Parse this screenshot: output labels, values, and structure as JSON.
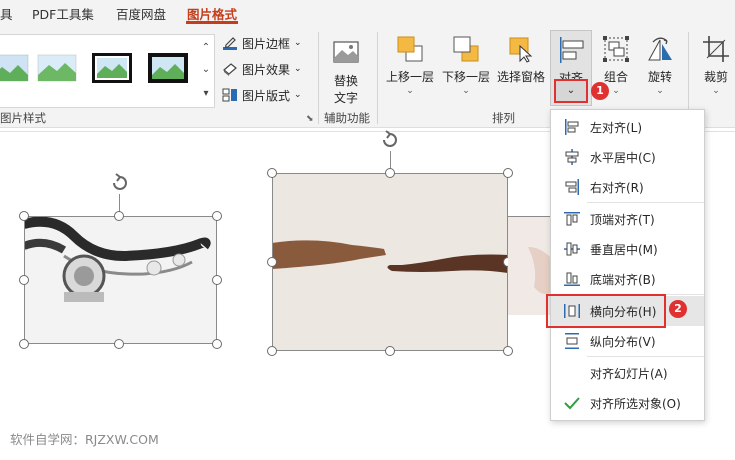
{
  "tabs": [
    {
      "label": "具",
      "active": false
    },
    {
      "label": "PDF工具集",
      "active": false
    },
    {
      "label": "百度网盘",
      "active": false
    },
    {
      "label": "图片格式",
      "active": true
    }
  ],
  "ribbon": {
    "picture_styles": {
      "group_label": "图片样式",
      "border_label": "图片边框",
      "effects_label": "图片效果",
      "layout_label": "图片版式"
    },
    "accessibility": {
      "group_label": "辅助功能",
      "alt_text_line1": "替换",
      "alt_text_line2": "文字"
    },
    "arrange": {
      "group_label": "排列",
      "bring_forward": "上移一层",
      "send_backward": "下移一层",
      "selection_pane": "选择窗格",
      "align": "对齐",
      "group": "组合",
      "rotate": "旋转"
    },
    "size": {
      "crop": "裁剪"
    }
  },
  "align_menu": {
    "items": [
      {
        "label": "左对齐(L)",
        "icon": "align-left-icon"
      },
      {
        "label": "水平居中(C)",
        "icon": "align-center-icon"
      },
      {
        "label": "右对齐(R)",
        "icon": "align-right-icon"
      },
      {
        "label": "顶端对齐(T)",
        "icon": "align-top-icon"
      },
      {
        "label": "垂直居中(M)",
        "icon": "align-middle-icon"
      },
      {
        "label": "底端对齐(B)",
        "icon": "align-bottom-icon"
      },
      {
        "label": "横向分布(H)",
        "icon": "distribute-horizontal-icon"
      },
      {
        "label": "纵向分布(V)",
        "icon": "distribute-vertical-icon"
      },
      {
        "label": "对齐幻灯片(A)",
        "icon": ""
      },
      {
        "label": "对齐所选对象(O)",
        "icon": "checkmark-icon"
      }
    ],
    "hovered_item": "横向分布(H)"
  },
  "annotations": {
    "badge_1": "1",
    "badge_2": "2"
  },
  "watermark": "软件自学网：RJZXW.COM",
  "colors": {
    "accent_tab": "#c43e1c",
    "highlight_red": "#e03131",
    "checkmark": "#2e9e3e",
    "icon_blue": "#2b6cb0",
    "icon_orange": "#f4b942"
  }
}
